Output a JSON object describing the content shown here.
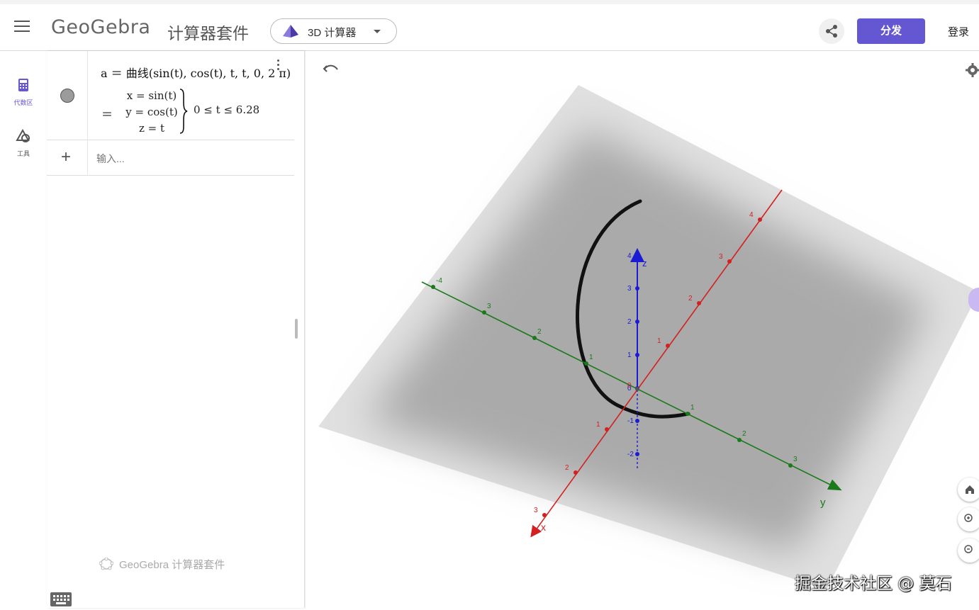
{
  "header": {
    "logo_text": "GeoGebra",
    "suite_title": "计算器套件",
    "app_selector_label": "3D 计算器",
    "publish_label": "分发",
    "login_label": "登录",
    "accent_color": "#6557d2"
  },
  "leftnav": {
    "items": [
      {
        "label": "代数区",
        "icon": "calculator-icon"
      },
      {
        "label": "工具",
        "icon": "tools-icon"
      }
    ]
  },
  "algebra": {
    "definition": "a ＝ 曲线(sin(t), cos(t), t, t, 0, 2 π)",
    "equals": "＝",
    "cases": [
      "x = sin(t)",
      "y = cos(t)",
      "z = t"
    ],
    "range": "0 ≤ t ≤ 6.28",
    "input_placeholder": "输入...",
    "footer_logo": "GeoGebra 计算器套件"
  },
  "view3d": {
    "axis_labels": {
      "x": "x",
      "y": "y",
      "z": "z"
    },
    "x_ticks": [
      "4",
      "3",
      "2",
      "1",
      "1",
      "2",
      "3"
    ],
    "y_ticks": [
      "-4",
      "3",
      "2",
      "1",
      "1",
      "2",
      "3"
    ],
    "z_ticks": [
      "4",
      "3",
      "2",
      "1",
      "0",
      "-1",
      "-2"
    ],
    "origin_label": "0",
    "axis_colors": {
      "x": "#d32020",
      "y": "#1a7a1a",
      "z": "#1b1bd6"
    },
    "watermark": "掘金技术社区 @ 莫石"
  }
}
